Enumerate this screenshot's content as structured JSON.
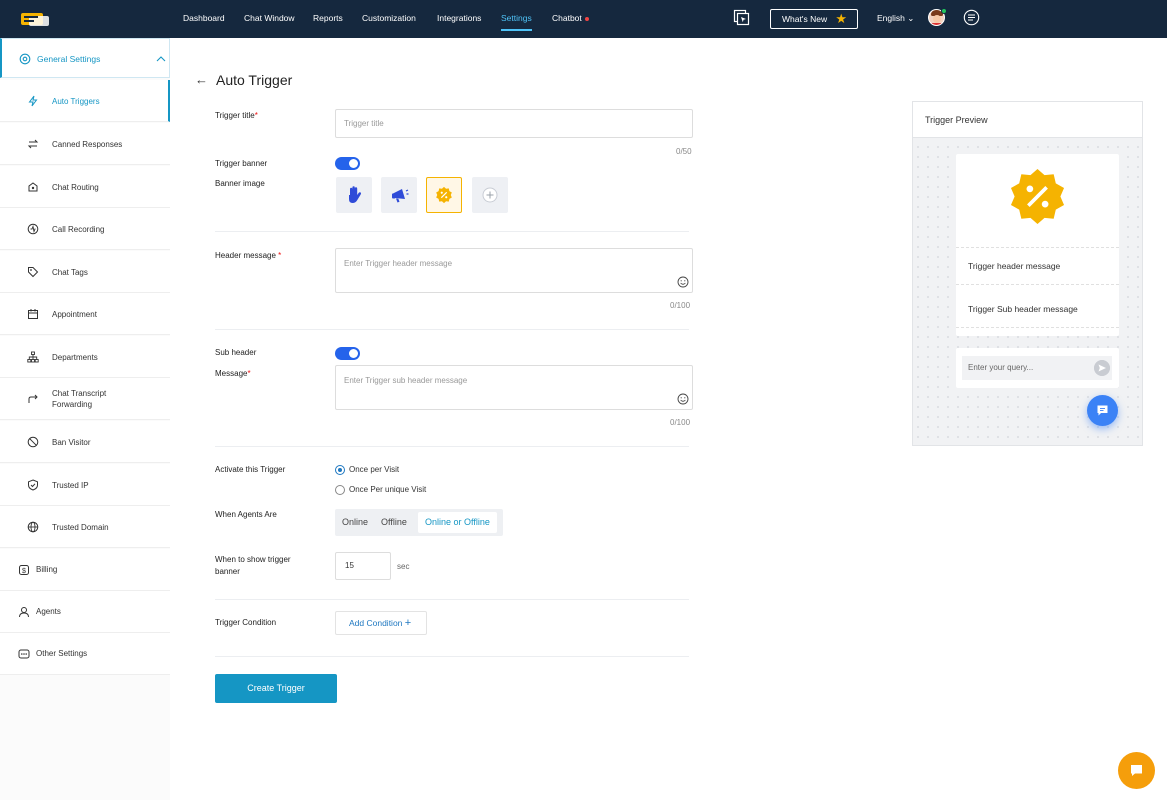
{
  "topnav": {
    "items": [
      "Dashboard",
      "Chat Window",
      "Reports",
      "Customization",
      "Integrations",
      "Settings",
      "Chatbot"
    ],
    "whats_new": "What's New",
    "language": "English"
  },
  "sidebar": {
    "group": "General Settings",
    "items": [
      "Auto Triggers",
      "Canned Responses",
      "Chat Routing",
      "Call Recording",
      "Chat Tags",
      "Appointment",
      "Departments",
      "Chat Transcript Forwarding",
      "Ban Visitor",
      "Trusted IP",
      "Trusted Domain"
    ],
    "top_items": [
      "Billing",
      "Agents",
      "Other Settings"
    ]
  },
  "page": {
    "title": "Auto Trigger"
  },
  "form": {
    "trigger_title_label": "Trigger title",
    "trigger_title_placeholder": "Trigger title",
    "trigger_title_count": "0/50",
    "trigger_banner_label": "Trigger banner",
    "banner_image_label": "Banner image",
    "header_message_label": "Header message",
    "header_message_placeholder": "Enter Trigger header message",
    "header_message_count": "0/100",
    "sub_header_label": "Sub header",
    "message_label": "Message",
    "message_placeholder": "Enter Trigger sub header message",
    "message_count": "0/100",
    "activate_label": "Activate this Trigger",
    "activate_options": [
      "Once per Visit",
      "Once Per unique Visit"
    ],
    "agents_label": "When Agents Are",
    "agents_options": [
      "Online",
      "Offline",
      "Online or Offline"
    ],
    "show_label": "When to show trigger banner",
    "show_value": "15",
    "show_unit": "sec",
    "condition_label": "Trigger Condition",
    "add_condition": "Add Condition",
    "create_button": "Create Trigger",
    "required_mark": "*"
  },
  "preview": {
    "title": "Trigger Preview",
    "header_message": "Trigger header message",
    "sub_header_message": "Trigger Sub header message",
    "query_placeholder": "Enter your query..."
  },
  "colors": {
    "topbar": "#15283e",
    "accent": "#1596c4",
    "toggle": "#2563eb",
    "banner": "#f5b301"
  }
}
